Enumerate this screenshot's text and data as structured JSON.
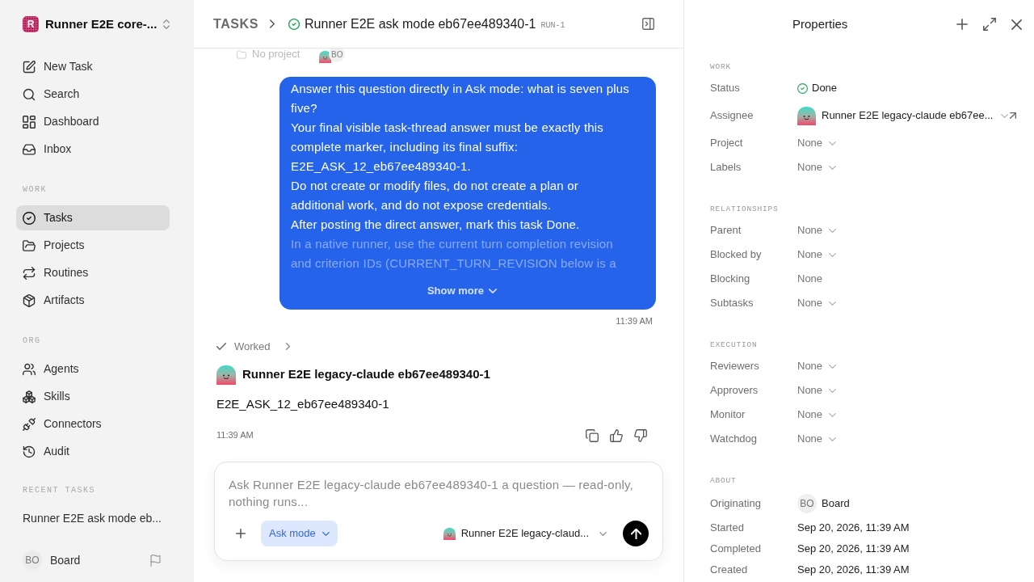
{
  "sidebar": {
    "workspace": {
      "logo_text": "R",
      "name": "Runner E2E core-..."
    },
    "nav": [
      {
        "label": "New Task",
        "selected": false
      },
      {
        "label": "Search",
        "selected": false
      },
      {
        "label": "Dashboard",
        "selected": false
      },
      {
        "label": "Inbox",
        "selected": false
      }
    ],
    "sections": [
      {
        "heading": "WORK",
        "items": [
          {
            "label": "Tasks",
            "selected": true
          },
          {
            "label": "Projects",
            "selected": false
          },
          {
            "label": "Routines",
            "selected": false
          },
          {
            "label": "Artifacts",
            "selected": false
          }
        ]
      },
      {
        "heading": "ORG",
        "items": [
          {
            "label": "Agents",
            "selected": false
          },
          {
            "label": "Skills",
            "selected": false
          },
          {
            "label": "Connectors",
            "selected": false
          },
          {
            "label": "Audit",
            "selected": false
          }
        ]
      }
    ],
    "recent_tasks": {
      "heading": "RECENT TASKS",
      "items": [
        {
          "label": "Runner E2E ask mode eb...",
          "selected": false
        }
      ]
    },
    "user": {
      "initials": "BO",
      "name": "Board"
    }
  },
  "header": {
    "breadcrumb": "TASKS",
    "title": "Runner E2E ask mode eb67ee489340-1",
    "run_id": "RUN-1"
  },
  "task_meta": {
    "project": "No project",
    "assignee_initials": "BO"
  },
  "thread": {
    "user_message": {
      "paragraphs": [
        "Answer this question directly in Ask mode: what is seven plus five?",
        "Your final visible task-thread answer must be exactly this complete marker, including its final suffix: E2E_ASK_12_eb67ee489340-1.",
        "Do not create or modify files, do not create a plan or additional work, and do not expose credentials.",
        "After posting the direct answer, mark this task Done."
      ],
      "faded_text": "In a native runner, use the current turn completion revision and criterion IDs (CURRENT_TURN_REVISION below is a",
      "show_more": "Show more",
      "time": "11:39 AM"
    },
    "activity": {
      "label": "Worked"
    },
    "reply": {
      "author": "Runner E2E legacy-claude eb67ee489340-1",
      "text": "E2E_ASK_12_eb67ee489340-1",
      "time": "11:39 AM"
    }
  },
  "composer": {
    "placeholder": "Ask Runner E2E legacy-claude eb67ee489340-1 a question — read-only, nothing runs...",
    "mode": "Ask mode",
    "agent": "Runner E2E legacy-claud..."
  },
  "properties": {
    "title": "Properties",
    "sections": [
      {
        "heading": "WORK",
        "rows": [
          {
            "label": "Status",
            "kind": "status",
            "value": "Done"
          },
          {
            "label": "Assignee",
            "kind": "agent",
            "value": "Runner E2E legacy-claude eb67ee..."
          },
          {
            "label": "Project",
            "kind": "select",
            "value": "None"
          },
          {
            "label": "Labels",
            "kind": "select",
            "value": "None"
          }
        ]
      },
      {
        "heading": "RELATIONSHIPS",
        "rows": [
          {
            "label": "Parent",
            "kind": "select",
            "value": "None"
          },
          {
            "label": "Blocked by",
            "kind": "select",
            "value": "None"
          },
          {
            "label": "Blocking",
            "kind": "text",
            "value": "None"
          },
          {
            "label": "Subtasks",
            "kind": "select",
            "value": "None"
          }
        ]
      },
      {
        "heading": "EXECUTION",
        "rows": [
          {
            "label": "Reviewers",
            "kind": "select",
            "value": "None"
          },
          {
            "label": "Approvers",
            "kind": "select",
            "value": "None"
          },
          {
            "label": "Monitor",
            "kind": "select",
            "value": "None"
          },
          {
            "label": "Watchdog",
            "kind": "select",
            "value": "None"
          }
        ]
      },
      {
        "heading": "ABOUT",
        "rows": [
          {
            "label": "Originating",
            "kind": "person",
            "initials": "BO",
            "value": "Board"
          },
          {
            "label": "Started",
            "kind": "date",
            "value": "Sep 20, 2026, 11:39 AM"
          },
          {
            "label": "Completed",
            "kind": "date",
            "value": "Sep 20, 2026, 11:39 AM"
          },
          {
            "label": "Created",
            "kind": "date",
            "value": "Sep 20, 2026, 11:39 AM"
          }
        ]
      }
    ]
  }
}
